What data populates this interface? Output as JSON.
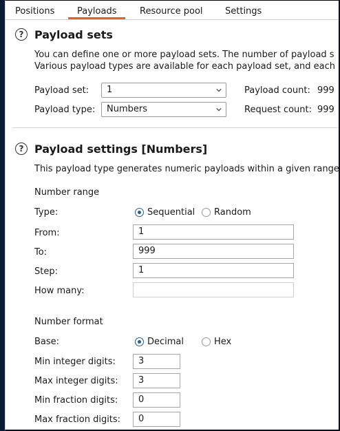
{
  "tabs": [
    "Positions",
    "Payloads",
    "Resource pool",
    "Settings"
  ],
  "active_tab": "Payloads",
  "payload_sets": {
    "title": "Payload sets",
    "desc_line1": "You can define one or more payload sets. The number of payload s",
    "desc_line2": "Various payload types are available for each payload set, and each",
    "set_label": "Payload set:",
    "set_value": "1",
    "type_label": "Payload type:",
    "type_value": "Numbers",
    "payload_count_label": "Payload count:",
    "payload_count": "999",
    "request_count_label": "Request count:",
    "request_count": "999"
  },
  "payload_settings": {
    "title": "Payload settings [Numbers]",
    "desc": "This payload type generates numeric payloads within a given range",
    "range_heading": "Number range",
    "type_label": "Type:",
    "type_options": [
      "Sequential",
      "Random"
    ],
    "type_selected": "Sequential",
    "from_label": "From:",
    "from_value": "1",
    "to_label": "To:",
    "to_value": "999",
    "step_label": "Step:",
    "step_value": "1",
    "how_many_label": "How many:",
    "how_many_value": "",
    "format_heading": "Number format",
    "base_label": "Base:",
    "base_options": [
      "Decimal",
      "Hex"
    ],
    "base_selected": "Decimal",
    "min_int_label": "Min integer digits:",
    "min_int_value": "3",
    "max_int_label": "Max integer digits:",
    "max_int_value": "3",
    "min_frac_label": "Min fraction digits:",
    "min_frac_value": "0",
    "max_frac_label": "Max fraction digits:",
    "max_frac_value": "0"
  },
  "colors": {
    "accent_tab": "#e2621f",
    "radio": "#2a5d8f",
    "background": "#0b1d33"
  },
  "icons": {
    "help": "help-circle-icon",
    "dropdown": "chevron-down-icon"
  }
}
